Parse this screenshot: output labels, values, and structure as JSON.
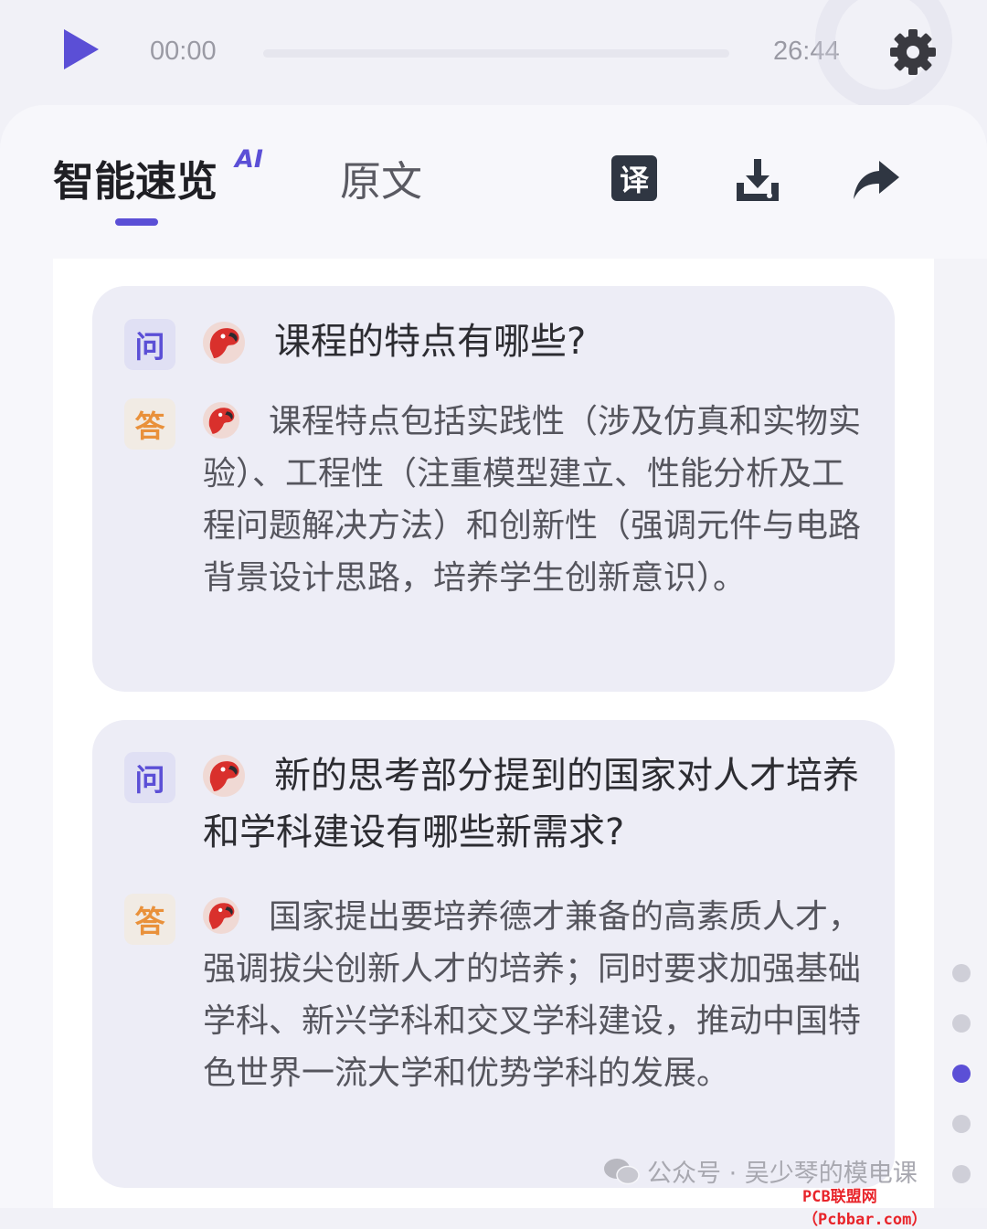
{
  "player": {
    "current_time": "00:00",
    "total_time": "26:44",
    "progress": 0,
    "play_icon": "play-icon",
    "settings_icon": "gear-icon"
  },
  "tabs": {
    "smart": "智能速览",
    "ai_badge": "AI",
    "original": "原文",
    "active": "smart"
  },
  "tools": {
    "translate_label": "译",
    "download_icon": "download-icon",
    "share_icon": "share-icon"
  },
  "qa": [
    {
      "q_tag": "问",
      "question": "课程的特点有哪些?",
      "a_tag": "答",
      "answer": "课程特点包括实践性（涉及仿真和实物实验）、工程性（注重模型建立、性能分析及工程问题解决方法）和创新性（强调元件与电路背景设计思路，培养学生创新意识）。"
    },
    {
      "q_tag": "问",
      "question": "新的思考部分提到的国家对人才培养和学科建设有哪些新需求?",
      "a_tag": "答",
      "answer": "国家提出要培养德才兼备的高素质人才，强调拔尖创新人才的培养；同时要求加强基础学科、新兴学科和交叉学科建设，推动中国特色世界一流大学和优势学科的发展。"
    }
  ],
  "pagination": {
    "count": 5,
    "active_index": 2
  },
  "watermark": "公众号 · 吴少琴的模电课",
  "site_mark": "PCB联盟网（Pcbbar.com）",
  "colors": {
    "accent": "#5b4fd6",
    "answer_tag": "#e9913b",
    "card_bg": "#ededf6"
  }
}
